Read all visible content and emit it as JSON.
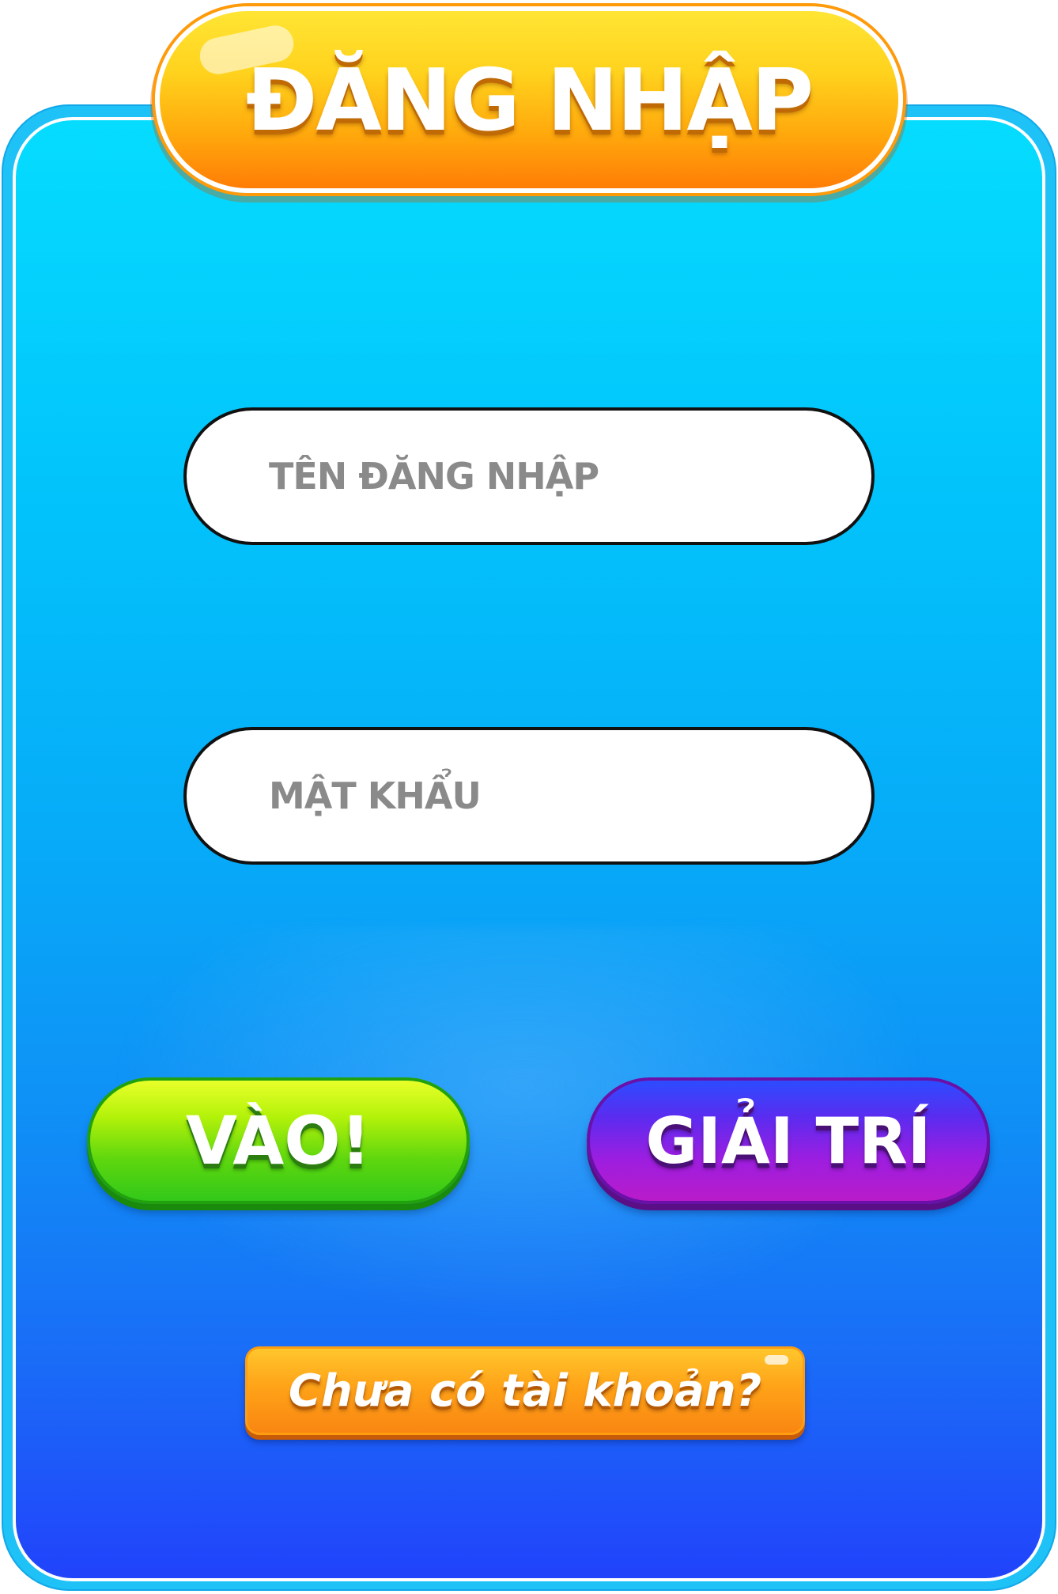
{
  "title": "ĐĂNG NHẬP",
  "form": {
    "username_placeholder": "TÊN ĐĂNG NHẬP",
    "password_placeholder": "MẬT KHẨU"
  },
  "buttons": {
    "enter_label": "VÀO!",
    "entertainment_label": "GIẢI TRÍ",
    "no_account_label": "Chưa có tài khoản?"
  },
  "colors": {
    "panel_top": "#05dcff",
    "panel_bottom": "#2143fb",
    "title_banner": "#ffa80c",
    "enter_button": "#5fd70e",
    "entertainment_button": "#9c1ee0",
    "signup_button": "#ffa318"
  }
}
